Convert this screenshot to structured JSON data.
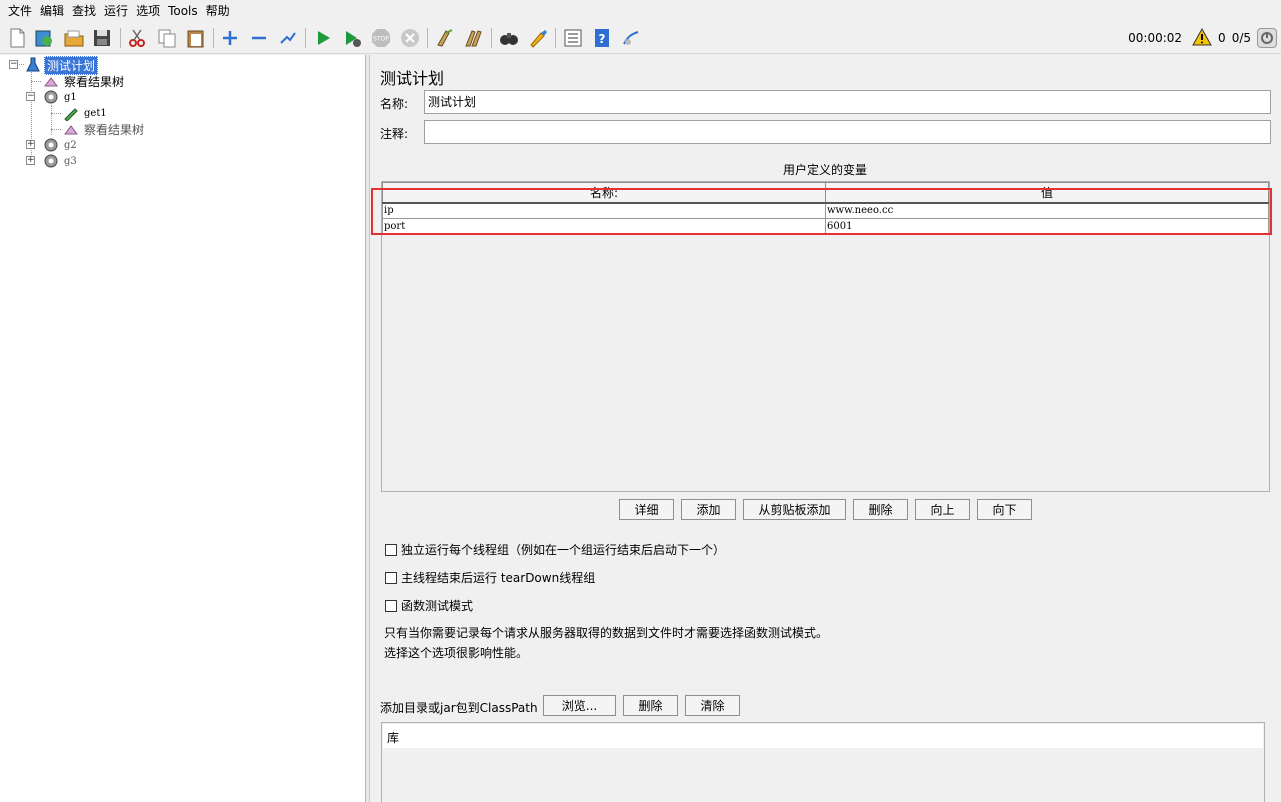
{
  "menu": [
    "文件",
    "编辑",
    "查找",
    "运行",
    "选项",
    "Tools",
    "帮助"
  ],
  "toolbar": {
    "icons": [
      "new-icon",
      "templates-icon",
      "open-icon",
      "save-icon",
      "cut-icon",
      "copy-icon",
      "paste-icon",
      "expand-icon",
      "collapse-icon",
      "toggle-icon",
      "start-icon",
      "start-no-pause-icon",
      "stop-icon",
      "shutdown-icon",
      "clear-icon",
      "clear-all-icon",
      "search-icon",
      "reset-search-icon",
      "function-helper-icon",
      "help-icon",
      "remote-icon"
    ]
  },
  "status": {
    "timer": "00:00:02",
    "warnings": "0",
    "threads": "0/5"
  },
  "tree": {
    "nodes": [
      {
        "label": "测试计划",
        "name": "tree-node-test-plan"
      },
      {
        "label": "察看结果树",
        "name": "tree-node-view-results-1"
      },
      {
        "label": "g1",
        "name": "tree-node-g1"
      },
      {
        "label": "get1",
        "name": "tree-node-get1"
      },
      {
        "label": "察看结果树",
        "name": "tree-node-view-results-2"
      },
      {
        "label": "g2",
        "name": "tree-node-g2"
      },
      {
        "label": "g3",
        "name": "tree-node-g3"
      }
    ]
  },
  "panel": {
    "title": "测试计划",
    "name_label": "名称:",
    "name_value": "测试计划",
    "comment_label": "注释:",
    "comment_value": "",
    "vars_heading": "用户定义的变量",
    "columns": [
      "名称:",
      "值"
    ],
    "rows": [
      {
        "name": "ip",
        "value": "www.neeo.cc"
      },
      {
        "name": "port",
        "value": "6001"
      }
    ],
    "buttons": [
      "详细",
      "添加",
      "从剪贴板添加",
      "删除",
      "向上",
      "向下"
    ],
    "checkboxes": [
      "独立运行每个线程组（例如在一个组运行结束后启动下一个）",
      "主线程结束后运行 tearDown线程组",
      "函数测试模式"
    ],
    "note_line1": "只有当你需要记录每个请求从服务器取得的数据到文件时才需要选择函数测试模式。",
    "note_line2": "选择这个选项很影响性能。",
    "classpath_label": "添加目录或jar包到ClassPath",
    "classpath_buttons": [
      "浏览...",
      "删除",
      "清除"
    ],
    "lib_header": "库"
  },
  "colors": {
    "selection": "#3875d7",
    "highlight_box": "#e23232"
  }
}
